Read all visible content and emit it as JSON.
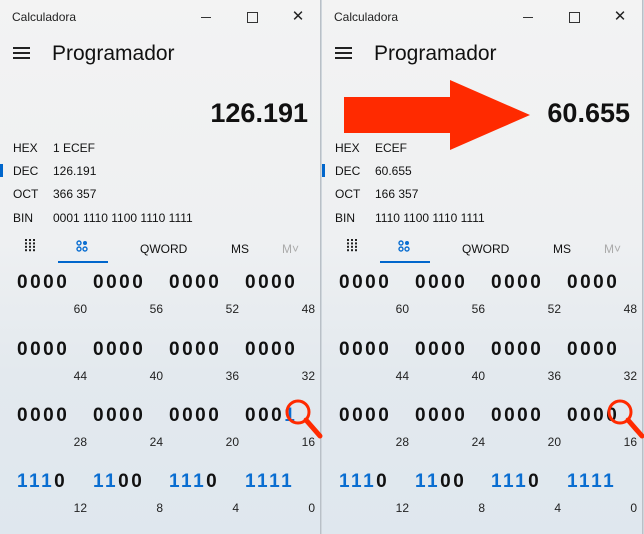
{
  "app_title": "Calculadora",
  "mode_title": "Programador",
  "toolbar": {
    "word_size": "QWORD",
    "ms": "MS",
    "mem": "M˅"
  },
  "windows": [
    {
      "display": "126.191",
      "radix": [
        {
          "name": "HEX",
          "value": "1 ECEF"
        },
        {
          "name": "DEC",
          "value": "126.191"
        },
        {
          "name": "OCT",
          "value": "366 357"
        },
        {
          "name": "BIN",
          "value": "0001 1110 1100 1110 1111"
        }
      ],
      "bit_rows": [
        [
          {
            "bits": "0000",
            "index": "60"
          },
          {
            "bits": "0000",
            "index": "56"
          },
          {
            "bits": "0000",
            "index": "52"
          },
          {
            "bits": "0000",
            "index": "48"
          }
        ],
        [
          {
            "bits": "0000",
            "index": "44"
          },
          {
            "bits": "0000",
            "index": "40"
          },
          {
            "bits": "0000",
            "index": "36"
          },
          {
            "bits": "0000",
            "index": "32"
          }
        ],
        [
          {
            "bits": "0000",
            "index": "28"
          },
          {
            "bits": "0000",
            "index": "24"
          },
          {
            "bits": "0000",
            "index": "20"
          },
          {
            "bits": "0001",
            "index": "16"
          }
        ],
        [
          {
            "bits": "1110",
            "index": "12"
          },
          {
            "bits": "1100",
            "index": "8"
          },
          {
            "bits": "1110",
            "index": "4"
          },
          {
            "bits": "1111",
            "index": "0"
          }
        ]
      ]
    },
    {
      "display": "60.655",
      "radix": [
        {
          "name": "HEX",
          "value": "ECEF"
        },
        {
          "name": "DEC",
          "value": "60.655"
        },
        {
          "name": "OCT",
          "value": "166 357"
        },
        {
          "name": "BIN",
          "value": "1110 1100 1110 1111"
        }
      ],
      "bit_rows": [
        [
          {
            "bits": "0000",
            "index": "60"
          },
          {
            "bits": "0000",
            "index": "56"
          },
          {
            "bits": "0000",
            "index": "52"
          },
          {
            "bits": "0000",
            "index": "48"
          }
        ],
        [
          {
            "bits": "0000",
            "index": "44"
          },
          {
            "bits": "0000",
            "index": "40"
          },
          {
            "bits": "0000",
            "index": "36"
          },
          {
            "bits": "0000",
            "index": "32"
          }
        ],
        [
          {
            "bits": "0000",
            "index": "28"
          },
          {
            "bits": "0000",
            "index": "24"
          },
          {
            "bits": "0000",
            "index": "20"
          },
          {
            "bits": "0000",
            "index": "16"
          }
        ],
        [
          {
            "bits": "1110",
            "index": "12"
          },
          {
            "bits": "1100",
            "index": "8"
          },
          {
            "bits": "1110",
            "index": "4"
          },
          {
            "bits": "1111",
            "index": "0"
          }
        ]
      ]
    }
  ],
  "colors": {
    "accent": "#0066cc",
    "bit_on": "#0a6ed1",
    "arrow": "#ff2a00",
    "magnifier": "#ff2a00"
  },
  "annotations": {
    "arrow_icon": "right-arrow-icon",
    "magnifier_icon": "magnifier-icon"
  }
}
